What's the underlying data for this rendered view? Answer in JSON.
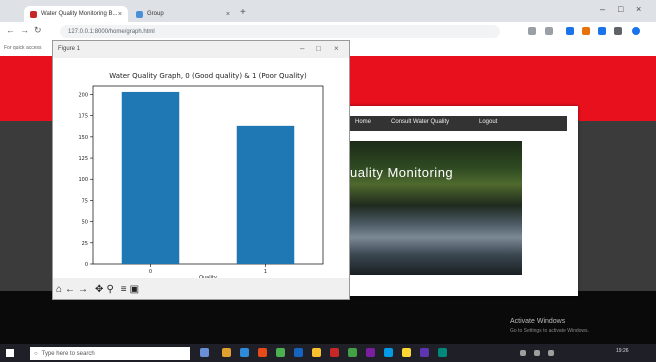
{
  "browser": {
    "tabs": [
      {
        "title": "Water Quality Monitoring B...",
        "active": true
      },
      {
        "title": "Group",
        "active": false
      }
    ],
    "url": "127.0.0.1:8000/home/graph.html",
    "bookmarks_text": "For quick access"
  },
  "website": {
    "nav_items": [
      "Home",
      "Consult Water Quality",
      "Logout"
    ],
    "hero_text": "uality Monitoring",
    "watermark_title": "Activate Windows",
    "watermark_sub": "Go to Settings to activate Windows."
  },
  "plot_window": {
    "title": "Figure 1",
    "toolbar_icons": [
      "home-icon",
      "back-icon",
      "forward-icon",
      "pan-icon",
      "zoom-icon",
      "configure-icon",
      "save-icon"
    ],
    "toolbar_glyphs": [
      "⌂",
      "←",
      "→",
      "✥",
      "⚲",
      "≡",
      "▣"
    ]
  },
  "chart_data": {
    "type": "bar",
    "title": "Water Quality Graph, 0 (Good quality) & 1 (Poor Quality)",
    "categories": [
      "0",
      "1"
    ],
    "values": [
      203,
      163
    ],
    "xlabel": "Quality",
    "ylabel": "",
    "ylim": [
      0,
      210
    ],
    "yticks": [
      0,
      25,
      50,
      75,
      100,
      125,
      150,
      175,
      200
    ],
    "bar_color": "#1f77b4"
  },
  "taskbar": {
    "search_placeholder": "Type here to search",
    "clock": "19:26"
  },
  "colors": {
    "page_red": "#e8101c",
    "page_dark": "#3b3b3b",
    "taskbar": "#1f1f28"
  }
}
